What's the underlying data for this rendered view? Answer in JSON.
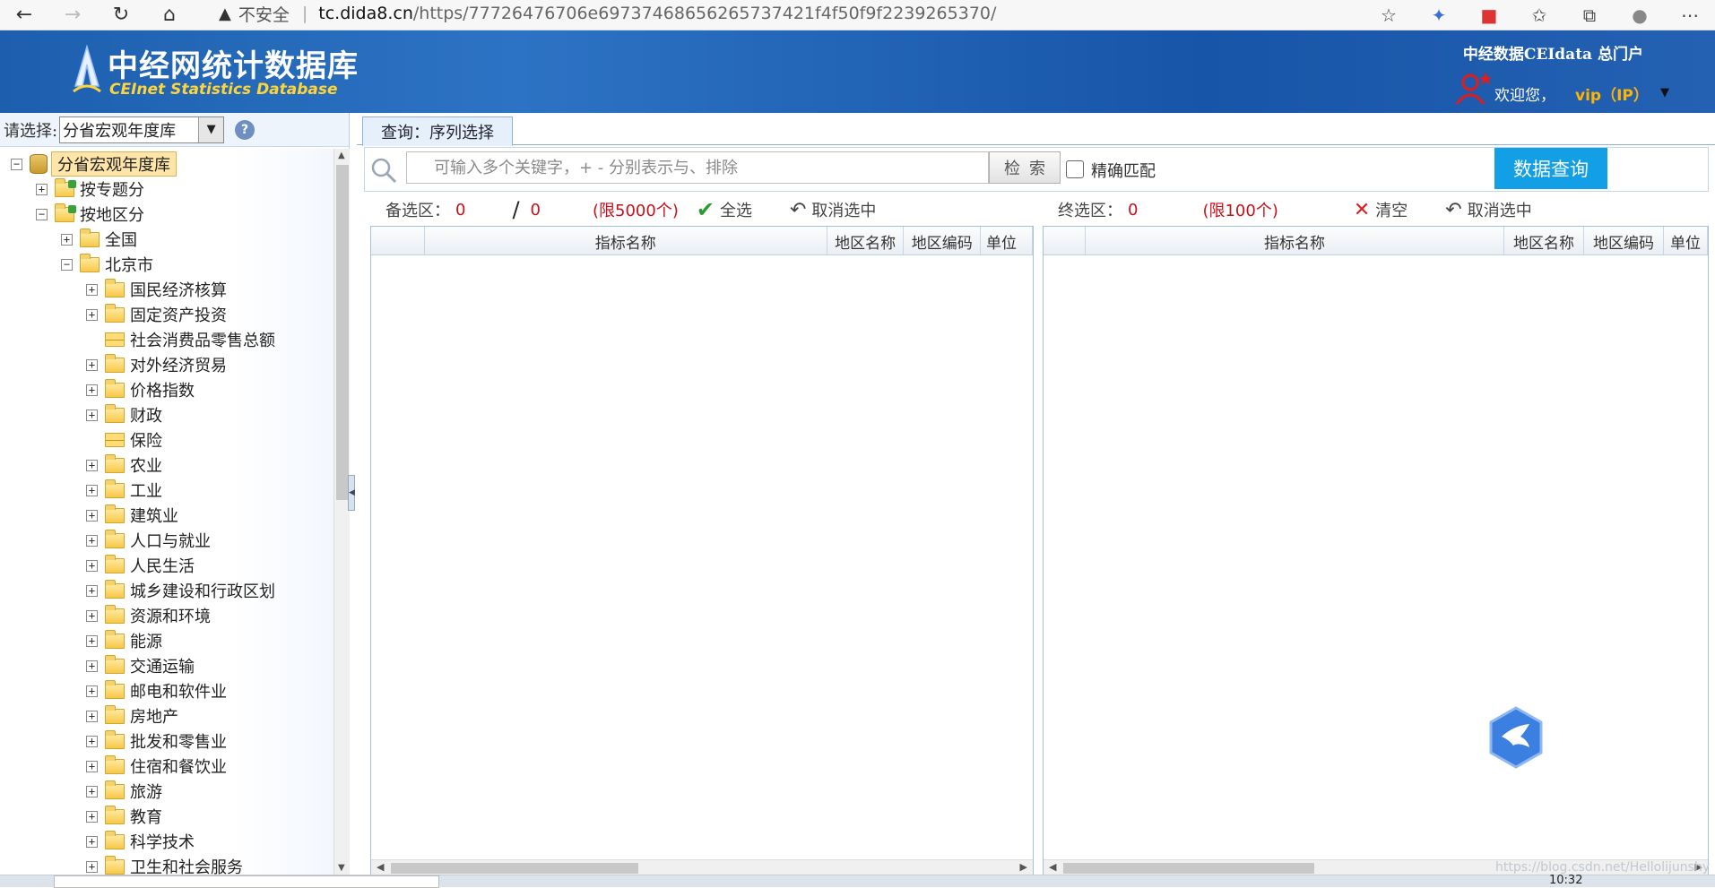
{
  "browser": {
    "back_icon": "arrow-left-icon",
    "forward_icon": "arrow-right-icon",
    "refresh_icon": "refresh-icon",
    "home_icon": "home-icon",
    "security_label": "不安全",
    "url_host": "tc.dida8.cn",
    "url_path": "/https/77726476706e69737468656265737421f4f50f9f2239265370/"
  },
  "header": {
    "logo_title": "中经网统计数据库",
    "logo_subtitle": "CEInet Statistics Database",
    "portal_link": "中经数据CEIdata 总门户",
    "welcome": "欢迎您，",
    "user": "vip（IP）"
  },
  "sidebar": {
    "select_label": "请选择:",
    "db_selected": "分省宏观年度库",
    "tree": [
      {
        "label": "分省宏观年度库",
        "level": 0,
        "toggle": "−",
        "icon": "db"
      },
      {
        "label": "按专题分",
        "level": 1,
        "toggle": "+",
        "icon": "special"
      },
      {
        "label": "按地区分",
        "level": 1,
        "toggle": "−",
        "icon": "special"
      },
      {
        "label": "全国",
        "level": 2,
        "toggle": "+",
        "icon": "folder"
      },
      {
        "label": "北京市",
        "level": 2,
        "toggle": "−",
        "icon": "folder"
      },
      {
        "label": "国民经济核算",
        "level": 3,
        "toggle": "+",
        "icon": "folder"
      },
      {
        "label": "固定资产投资",
        "level": 3,
        "toggle": "+",
        "icon": "folder"
      },
      {
        "label": "社会消费品零售总额",
        "level": 3,
        "toggle": "",
        "icon": "mail"
      },
      {
        "label": "对外经济贸易",
        "level": 3,
        "toggle": "+",
        "icon": "folder"
      },
      {
        "label": "价格指数",
        "level": 3,
        "toggle": "+",
        "icon": "folder"
      },
      {
        "label": "财政",
        "level": 3,
        "toggle": "+",
        "icon": "folder"
      },
      {
        "label": "保险",
        "level": 3,
        "toggle": "",
        "icon": "mail"
      },
      {
        "label": "农业",
        "level": 3,
        "toggle": "+",
        "icon": "folder"
      },
      {
        "label": "工业",
        "level": 3,
        "toggle": "+",
        "icon": "folder"
      },
      {
        "label": "建筑业",
        "level": 3,
        "toggle": "+",
        "icon": "folder"
      },
      {
        "label": "人口与就业",
        "level": 3,
        "toggle": "+",
        "icon": "folder"
      },
      {
        "label": "人民生活",
        "level": 3,
        "toggle": "+",
        "icon": "folder"
      },
      {
        "label": "城乡建设和行政区划",
        "level": 3,
        "toggle": "+",
        "icon": "folder"
      },
      {
        "label": "资源和环境",
        "level": 3,
        "toggle": "+",
        "icon": "folder"
      },
      {
        "label": "能源",
        "level": 3,
        "toggle": "+",
        "icon": "folder"
      },
      {
        "label": "交通运输",
        "level": 3,
        "toggle": "+",
        "icon": "folder"
      },
      {
        "label": "邮电和软件业",
        "level": 3,
        "toggle": "+",
        "icon": "folder"
      },
      {
        "label": "房地产",
        "level": 3,
        "toggle": "+",
        "icon": "folder"
      },
      {
        "label": "批发和零售业",
        "level": 3,
        "toggle": "+",
        "icon": "folder"
      },
      {
        "label": "住宿和餐饮业",
        "level": 3,
        "toggle": "+",
        "icon": "folder"
      },
      {
        "label": "旅游",
        "level": 3,
        "toggle": "+",
        "icon": "folder"
      },
      {
        "label": "教育",
        "level": 3,
        "toggle": "+",
        "icon": "folder"
      },
      {
        "label": "科学技术",
        "level": 3,
        "toggle": "+",
        "icon": "folder"
      },
      {
        "label": "卫生和社会服务",
        "level": 3,
        "toggle": "+",
        "icon": "folder"
      }
    ]
  },
  "main": {
    "tab_label": "查询：序列选择",
    "search_placeholder": "可输入多个关键字，+ - 分别表示与、排除",
    "search_button": "检索",
    "exact_match": "精确匹配",
    "query_button": "数据查询",
    "candidate": {
      "label": "备选区：",
      "count": "0",
      "slash": "/",
      "total": "0",
      "limit": "(限5000个)",
      "select_all": "全选",
      "deselect": "取消选中",
      "columns": [
        "",
        "指标名称",
        "地区名称",
        "地区编码",
        "单位"
      ]
    },
    "final": {
      "label": "终选区：",
      "count": "0",
      "limit": "(限100个)",
      "clear": "清空",
      "deselect": "取消选中",
      "columns": [
        "",
        "指标名称",
        "地区名称",
        "地区编码",
        "单位"
      ]
    }
  },
  "colors": {
    "header_blue": "#1d5fae",
    "query_button": "#129fe6",
    "count_red": "#c8101a",
    "vip_orange": "#ffb400"
  },
  "taskbar": {
    "clock": "10:32"
  },
  "watermark": "https://blog.csdn.net/Hellolijunshy"
}
